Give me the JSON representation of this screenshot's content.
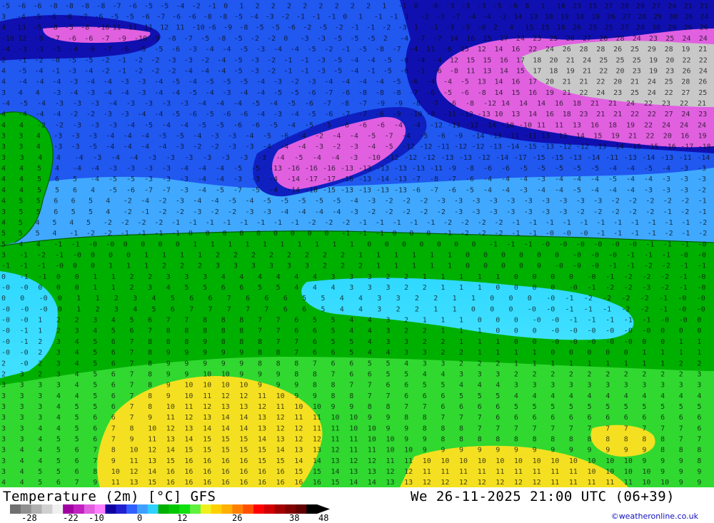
{
  "map": {
    "rows": [
      "-5 -6 -6 -8 -8 -8 -8 -7 -6 -5 -5 -4 -2 -1 0 1 2 2 2 2 2 2 2 2 1 -1 0 -6 -3 -3 -3 -5 -6 8 1 16 23 15 27 28 29 27 24 21 21",
      "3 -4 -5 -6 -8 -7 -6 -5 -5 -6 -7 -6 -6 -8 -8 -5 -4 -3 -2 -1 -1 -1 0 1 -1 -1 1 -2 -3 -7 -4 -4 -2 14 13 18 19 18 19 26 27 28 29 30 26 24",
      "4 13 -5 -8 -5 -8 -10 11 11 11 12 11 -10 -6 -9 -8 -5 -5 -6 -2 -5 -2 -1 -1 -2 -3 1 -1 -3 -5 -6 2 4 15 15 18 26 25 25 27 28 30 29 26 26",
      "-10 12 -8 -7 -6 -6 -7 -9 -10 -9 -8 -7 -5 -8 -5 -2 -2 0 -3 -3 -5 -5 -5 2 -4 -7 -7 14 16 15 17 24 23 25 26 27 26 28 24 23 25 24 24",
      "-4 -3 -1 -5 -4 -6 -7 -6 -5 -5 -6 -3 -4 -4 -5 -3 -4 -4 -5 -2 -1 -5 -8 -7 -4 11 -6 15 12 14 16 22 24 26 28 28 26 25 29 28 19 21",
      "2 -1 -2 -0 -5 -5 -2 -1 -2 -2 -3 -3 -2 -4 -5 -3 -2 -1 -1 -3 -5 -4 -4 -5 -6 -4 -4 12 15 15 16 17 18 20 21 24 25 25 25 19 20 22 22",
      "4 -5 -4 -1 -3 -4 -2 -1 -2 -2 -2 -4 -4 -4 -5 -3 -2 -1 -1 -3 -5 -4 -1 -5 -6 -1 -6 -8 11 13 14 15 17 18 19 21 22 20 23 19 23 26 24",
      "4 -4 -4 -4 -3 -4 -4 -3 -3 -4 -5 -4 -5 -5 -5 -4 -3 -2 -3 -4 -4 -4 -4 -5 -6 -4 -4 -5 13 14 16 17 20 21 21 22 20 21 24 25 28 26",
      "3 4 4 -3 -4 -3 -4 -4 -3 -4 -4 -5 -4 -3 -4 -4 -5 -5 -6 -7 -6 -8 -8 -8 -7 -6 -5 -6 -8 14 15 16 19 21 22 24 23 25 24 22 27 25",
      "-4 -5 -4 -3 -3 -3 -4 -3 -3 -3 -3 -4 -4 -4 -5 -4 -5 -6 -7 -8 -7 -9 -9 -8 -7 -6 -8 -12 14 14 14 16 18 21 21 24 22 23 22 21",
      "4 -4 -4 -4 -2 -2 -3 -3 -4 -4 -5 -6 -5 -6 -6 -4 -3 -4 -5 -6 -7 -7 -6 -9 -10 -8 -11 -12 -13 10 13 14 16 18 23 21 21 22 22 27 24 23",
      "4 4 -2 -2 -3 -3 -3 -4 -5 -4 -4 -5 -5 -6 -6 -5 -4 -5 -5 -6 -6 -6 -4 -4 -12 -11 -12 -14 -10 -10 11 11 13 16 18 19 22 24 24 24",
      "3 3 4 -3 -3 -3 -4 -4 -4 -5 -5 -4 -3 -3 -4 -5 -6 -4 -2 -4 -4 -5 -7 -4 -5 -6 -9 -14 -13 -11 -11 13 13 14 15 19 21 22 20 16 19",
      "3 3 4 -3 -3 -5 -4 -4 -4 -4 -3 -2 -2 -3 -3 -4 -4 -4 -3 -2 -3 -4 -5 -12 -12 -11 -12 -12 -13 -14 -15 -13 -12 -12 -13 -14 -15 -15 -16 -17 -18",
      "3 3 4 4 -4 -3 -4 -4 -3 -3 -3 -3 -3 -3 -3 -4 -5 -4 -4 -3 -10 -12 -12 -12 -13 -13 -12 -14 -17 -15 -15 -13 -14 -11 -13 -14 -13 -11 -14",
      "4 4 5 4 -4 -4 -3 -3 -3 -3 -4 -4 -4 -5 -5 -13 -16 -16 -16 -13 -13 -13 -13 -13 -11 -9 -8 -6 -6 -5 -5 -5 -5 -5 -4 -4 -5 -4 -3 -3",
      "4 4 5 6 5 -4 -5 -5 -3 -3 -3 -4 -4 -3 -3 -4 -14 -17 -17 -16 -13 -14 -13 -7 -8 -7 -6 -4 -4 -4 -3 -4 -4 -4 -5 -4 -4 -3 -3 -3",
      "4 4 5 5 6 4 -5 -6 -7 -7 -3 -4 -5 -7 -5 -4 -14 -18 -15 -13 -13 -13 -13 -6 -7 -6 -5 -4 -4 -3 -4 -4 -5 -4 -4 -4 -3 -3 -3 -2",
      "4 5 5 6 6 5 4 -2 -4 -2 -3 -4 -4 -5 -4 -5 -5 -5 -5 -5 -4 -3 -2 -2 -2 -3 -3 -3 -3 -3 -3 -3 -3 -3 -3 -2 -2 -2 -2 -2 -1",
      "3 5 5 6 5 5 4 -2 -1 -2 -2 -3 -2 -2 -3 -3 -4 -4 -4 -4 -3 -2 -2 -2 -2 -2 -3 -3 -3 -3 -3 -3 -3 -2 -2 -2 -2 -2 -1 -2 -1",
      "4 5 4 5 4 5 -2 -2 -2 -2 -1 -1 -1 -1 -1 -1 -1 -1 -2 -2 -2 -1 -1 -1 -1 -1 -2 -2 -2 -2 -1 -1 -1 -1 -1 -1 -1 -1 -1 -1 -1 -2",
      "5 5 5 4 -1 -2 -2 -1 -1 -1 -1 0 0 0 0 0 0 0 0 0 -1 -1 -1 0 0 0 -1 -2 -2 -2 -1 -1 -0 -0 -0 -1 -1 -1 -1 -2 -1 -2",
      "5 4 4 -1 -1 -0 -0 0 0 0 0 1 1 1 1 1 1 1 1 1 1 0 0 0 0 0 0 0 -1 -1 -1 -0 -0 -0 -0 -0 -0 -1 -1 -1 -0",
      "3 -1 -2 -1 -0 0 0 0 1 1 1 1 2 2 2 2 2 2 2 2 1 1 1 1 1 1 0 0 0 0 0 0 -0 -0 -0 -1 -1 -1 -0 -0",
      "-1 -1 -1 -0 0 0 1 1 1 2 2 2 3 3 3 3 3 3 2 2 2 1 1 1 1 1 0 0 0 0 0 -0 -0 -0 -1 -1 -2 -2 -1 -1",
      "0 -1 -1 0 0 1 1 2 2 3 3 3 4 4 4 4 4 4 3 3 3 2 2 1 1 1 1 1 0 0 0 0 -0 -1 -2 -2 -2 -1 -0",
      "-0 -0 0 0 0 1 1 2 3 4 5 5 6 6 5 5 4 4 4 3 3 3 2 2 1 1 1 0 0 0 0 -0 -1 -2 -2 -3 -2 -1 -0",
      "0 0 -0 0 1 1 2 3 4 5 6 6 7 6 6 6 5 5 4 4 3 3 2 2 1 1 0 0 0 -0 -1 -2 -2 -2 -2 -1 -0 -0",
      "-0 -0 -0 0 1 2 3 4 5 6 7 7 7 7 7 6 6 5 4 4 3 2 2 1 1 0 0 0 -0 -0 -1 -1 -1 -2 -2 -1 -0 -0",
      "-0 -0 1 2 2 3 4 5 6 7 7 8 8 8 7 7 6 5 5 4 4 3 2 1 1 1 0 0 0 -0 -0 -1 -1 -1 -1 -1 -0 -0 0",
      "-0 -1 1 2 3 4 5 6 7 8 8 8 8 8 7 7 6 6 5 4 4 3 2 2 1 1 1 0 0 0 -0 -0 -0 -0 -0 -0 0 0 0",
      "-0 -1 2 3 4 5 6 7 8 8 8 9 8 8 8 7 7 6 5 5 4 3 3 2 2 1 1 1 0 0 -0 -0 -0 -0 -0 0 0 1 1",
      "-0 -0 2 3 4 5 6 7 8 9 9 9 9 9 8 8 7 6 6 5 4 4 3 3 2 2 1 1 1 1 0 0 0 0 0 1 1 1 1",
      "2 -0 2 3 4 5 6 7 8 9 9 9 9 9 8 8 8 7 6 6 5 5 4 3 3 2 2 2 1 1 1 1 1 1 1 1 1 2 2",
      "2 3 2 3 4 5 6 7 8 9 9 10 10 9 9 9 8 8 7 6 6 5 5 4 4 3 3 3 2 2 2 2 2 2 2 2 2 2 3",
      "3 3 3 3 4 5 6 7 8 9 10 10 10 10 9 9 9 8 8 7 7 6 6 5 5 4 4 4 3 3 3 3 3 3 3 3 3 3 3",
      "3 3 3 4 4 5 6 7 8 9 10 11 12 12 11 10 9 9 8 8 7 7 6 6 6 5 5 5 4 4 4 4 4 4 4 4 4 4 4",
      "3 3 3 4 5 5 6 7 8 10 11 12 13 13 12 11 10 10 9 9 8 8 7 7 6 6 6 6 5 5 5 5 5 5 5 5 5 5 5",
      "3 3 3 4 5 6 6 7 9 11 12 13 14 14 13 12 11 11 10 10 9 9 8 8 7 7 7 6 6 6 6 6 6 6 6 6 6 6 6",
      "3 3 4 4 5 6 7 8 10 12 13 14 14 14 13 12 12 11 11 10 10 9 9 8 8 8 7 7 7 7 7 7 7 7 7 7 7 7 6",
      "3 3 4 5 5 6 7 9 11 13 14 15 15 15 14 13 12 12 11 11 10 10 9 9 8 8 8 8 8 8 8 8 8 8 8 8 8 7 7",
      "3 4 4 5 6 7 8 10 12 14 15 15 15 15 15 14 13 13 12 11 11 10 10 9 9 9 9 9 9 9 9 9 9 9 9 9 8 8 8",
      "3 4 4 5 6 7 9 11 13 15 16 16 16 16 15 15 14 14 13 12 12 11 11 10 10 10 10 10 10 10 10 10 10 10 10 9 9 9 8",
      "3 4 5 5 6 8 10 12 14 16 16 16 16 16 16 16 15 15 14 13 13 12 12 11 11 11 11 11 11 11 11 11 10 10 10 10 9 9 9",
      "4 4 5 6 7 9 11 13 15 16 16 16 16 16 16 16 16 16 15 14 14 13 13 12 12 12 12 12 12 12 11 11 11 11 11 10 10 9 9"
    ]
  },
  "footer": {
    "title": "Temperature (2m) [°C] GFS",
    "datetime": "We 26-11-2025 21:00 UTC (06+39)",
    "credit": "©weatheronline.co.uk"
  },
  "legend": {
    "ticks": [
      "-28",
      "-22",
      "-10",
      "0",
      "12",
      "26",
      "38",
      "48"
    ],
    "colors": [
      "#707070",
      "#909090",
      "#b0b0b0",
      "#d0d0d0",
      "#f0f0f0",
      "#a000a0",
      "#c020c0",
      "#e060e0",
      "#ff80ff",
      "#1000a0",
      "#2020d0",
      "#3060ff",
      "#40a0ff",
      "#30d0ff",
      "#00b000",
      "#00c800",
      "#10e010",
      "#60f040",
      "#f0f020",
      "#ffd000",
      "#ffb000",
      "#ff8000",
      "#ff5000",
      "#ff0000",
      "#d00000",
      "#a00000",
      "#800000",
      "#600000",
      "#000000"
    ]
  }
}
